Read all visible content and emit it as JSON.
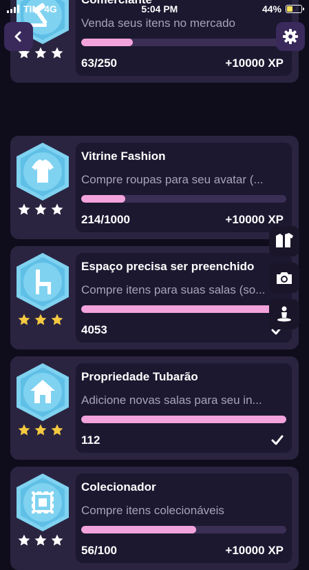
{
  "status_bar": {
    "carrier": "TIM",
    "network": "4G",
    "time": "5:04 PM",
    "battery": "44%",
    "battery_level": 0.44
  },
  "colors": {
    "background": "#0f0d1c",
    "card": "#2a2440",
    "card_inner": "#1c1830",
    "progress_fill": "#f3a3dc",
    "progress_track": "#3b2f55",
    "badge": "#7fd2f0",
    "star_gold": "#f5c940",
    "star_white": "#ffffff"
  },
  "achievements": [
    {
      "title": "Comerciante",
      "description": "Venda seus itens no mercado",
      "progress_text": "63/250",
      "progress": 0.252,
      "reward": "+10000 XP",
      "completed": false,
      "stars": "white",
      "icon": "gavel-icon"
    },
    {
      "title": "Vitrine Fashion",
      "description": "Compre roupas para seu avatar (...",
      "progress_text": "214/1000",
      "progress": 0.214,
      "reward": "+10000 XP",
      "completed": false,
      "stars": "white",
      "icon": "shirt-icon"
    },
    {
      "title": "Espaço precisa ser preenchido",
      "description": "Compre itens para suas salas (so...",
      "progress_text": "4053",
      "progress": 1,
      "reward": "",
      "completed": true,
      "stars": "gold",
      "icon": "chair-icon"
    },
    {
      "title": "Propriedade Tubarão",
      "description": "Adicione novas salas para seu in...",
      "progress_text": "112",
      "progress": 1,
      "reward": "",
      "completed": true,
      "stars": "gold",
      "icon": "house-icon"
    },
    {
      "title": "Colecionador",
      "description": "Compre itens colecionáveis",
      "progress_text": "56/100",
      "progress": 0.56,
      "reward": "+10000 XP",
      "completed": false,
      "stars": "white",
      "icon": "stamp-icon"
    }
  ],
  "side_tools": [
    "wardrobe-icon",
    "camera-icon",
    "avatar-pose-icon"
  ]
}
